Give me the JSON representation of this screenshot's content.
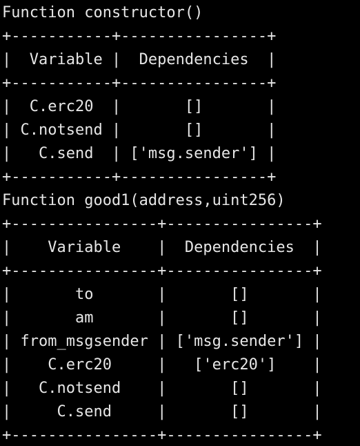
{
  "terminal": {
    "background": "#000000",
    "foreground": "#e6e6e6",
    "lines": [
      "Function constructor()",
      "+-----------+----------------+",
      "|  Variable |  Dependencies  |",
      "+-----------+----------------+",
      "|  C.erc20  |       []       |",
      "| C.notsend |       []       |",
      "|   C.send  | ['msg.sender'] |",
      "+-----------+----------------+",
      "Function good1(address,uint256)",
      "+----------------+----------------+",
      "|    Variable    |  Dependencies  |",
      "+----------------+----------------+",
      "|       to       |       []       |",
      "|       am       |       []       |",
      "| from_msgsender | ['msg.sender'] |",
      "|    C.erc20     |   ['erc20']    |",
      "|   C.notsend    |       []       |",
      "|     C.send     |       []       |",
      "+----------------+----------------+"
    ]
  }
}
